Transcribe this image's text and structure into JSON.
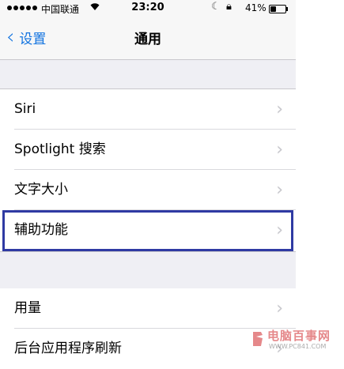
{
  "status_bar": {
    "carrier": "中国联通",
    "time": "23:20",
    "battery_pct": "41%",
    "battery_level": 0.41,
    "signal_icon": "signal-dots-icon",
    "wifi_icon": "wifi-icon",
    "moon_icon": "moon-icon",
    "lock_icon": "rotation-lock-icon"
  },
  "nav": {
    "back_label": "设置",
    "title": "通用",
    "accent_color": "#1173e0"
  },
  "sections": [
    {
      "items": [
        {
          "label": "Siri"
        },
        {
          "label": "Spotlight 搜索"
        },
        {
          "label": "文字大小"
        },
        {
          "label": "辅助功能",
          "highlighted": true
        }
      ]
    },
    {
      "items": [
        {
          "label": "用量"
        },
        {
          "label": "后台应用程序刷新"
        }
      ]
    }
  ],
  "highlight_color": "#2f3aa3",
  "watermark": {
    "text": "电脑百事网",
    "url": "WWW.PC841.COM"
  }
}
